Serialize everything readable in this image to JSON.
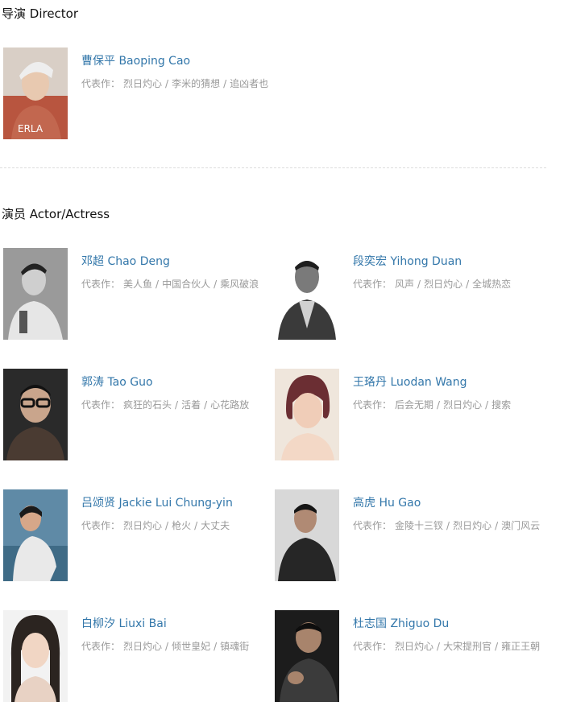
{
  "director_section": {
    "title": "导演 Director",
    "people": [
      {
        "name": "曹保平 Baoping Cao",
        "works_prefix": "代表作：",
        "works": [
          "烈日灼心",
          "李米的猜想",
          "追凶者也"
        ],
        "photo": "portrait-photo"
      }
    ]
  },
  "actor_section": {
    "title": "演员 Actor/Actress",
    "people": [
      {
        "name": "邓超 Chao Deng",
        "works_prefix": "代表作：",
        "works": [
          "美人鱼",
          "中国合伙人",
          "乘风破浪"
        ],
        "photo": "portrait-photo"
      },
      {
        "name": "段奕宏 Yihong Duan",
        "works_prefix": "代表作：",
        "works": [
          "风声",
          "烈日灼心",
          "全城热恋"
        ],
        "photo": "portrait-photo"
      },
      {
        "name": "郭涛 Tao Guo",
        "works_prefix": "代表作：",
        "works": [
          "疯狂的石头",
          "活着",
          "心花路放"
        ],
        "photo": "portrait-photo"
      },
      {
        "name": "王珞丹 Luodan Wang",
        "works_prefix": "代表作：",
        "works": [
          "后会无期",
          "烈日灼心",
          "搜索"
        ],
        "photo": "portrait-photo"
      },
      {
        "name": "吕颂贤 Jackie Lui Chung-yin",
        "works_prefix": "代表作：",
        "works": [
          "烈日灼心",
          "枪火",
          "大丈夫"
        ],
        "photo": "portrait-photo"
      },
      {
        "name": "高虎 Hu Gao",
        "works_prefix": "代表作：",
        "works": [
          "金陵十三钗",
          "烈日灼心",
          "澳门风云"
        ],
        "photo": "portrait-photo"
      },
      {
        "name": "白柳汐 Liuxi Bai",
        "works_prefix": "代表作：",
        "works": [
          "烈日灼心",
          "倾世皇妃",
          "镇魂街"
        ],
        "photo": "portrait-photo"
      },
      {
        "name": "杜志国 Zhiguo Du",
        "works_prefix": "代表作：",
        "works": [
          "烈日灼心",
          "大宋提刑官",
          "雍正王朝"
        ],
        "photo": "portrait-photo"
      }
    ]
  },
  "colors": {
    "link": "#3377aa",
    "muted": "#999999",
    "divider": "#dddddd"
  }
}
